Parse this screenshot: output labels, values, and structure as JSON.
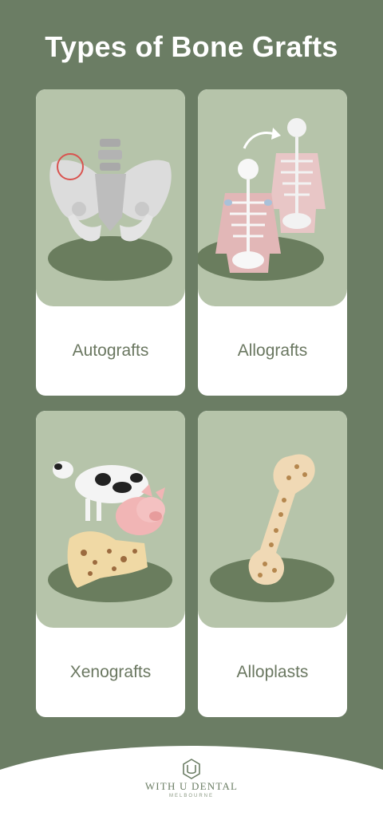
{
  "header": {
    "title": "Types of Bone Grafts"
  },
  "cards": [
    {
      "label": "Autografts",
      "icon": "pelvis-icon"
    },
    {
      "label": "Allografts",
      "icon": "skeleton-transfer-icon"
    },
    {
      "label": "Xenografts",
      "icon": "cow-pig-bone-icon"
    },
    {
      "label": "Alloplasts",
      "icon": "synthetic-bone-icon"
    }
  ],
  "footer": {
    "brand": "WITH U DENTAL",
    "location": "MELBOURNE"
  },
  "colors": {
    "background": "#6b7d64",
    "panel": "#b6c4aa",
    "ground": "#6a7d5e",
    "text": "#6a7760"
  }
}
